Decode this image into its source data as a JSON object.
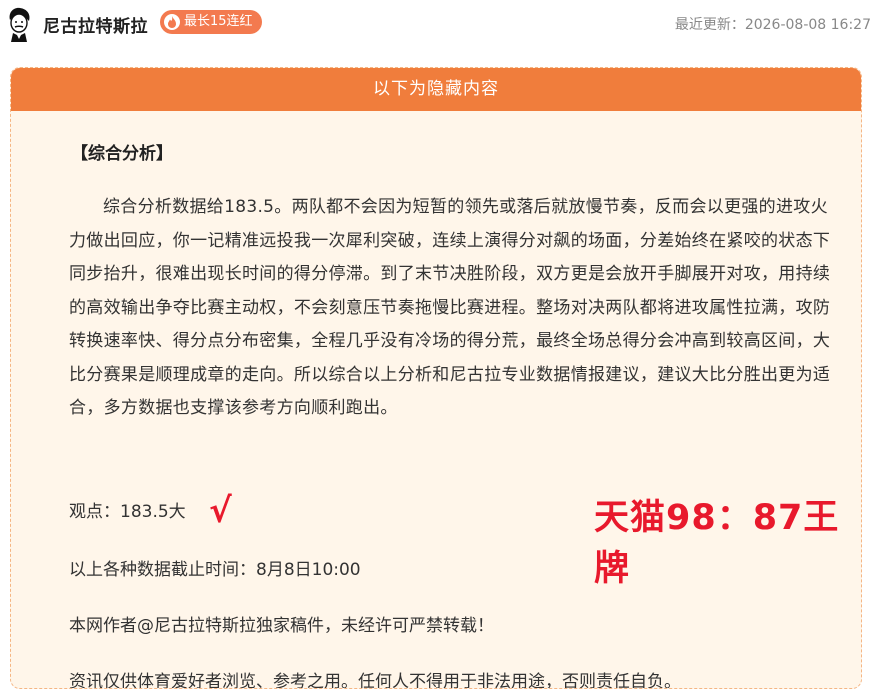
{
  "header": {
    "author_name": "尼古拉特斯拉",
    "streak_badge": "最长15连红",
    "updated": "最近更新：2026-08-08 16:27"
  },
  "card": {
    "banner": "以下为隐藏内容",
    "section_title": "【综合分析】",
    "paragraph": "综合分析数据给183.5。两队都不会因为短暂的领先或落后就放慢节奏，反而会以更强的进攻火力做出回应，你一记精准远投我一次犀利突破，连续上演得分对飙的场面，分差始终在紧咬的状态下同步抬升，很难出现长时间的得分停滞。到了末节决胜阶段，双方更是会放开手脚展开对攻，用持续的高效输出争夺比赛主动权，不会刻意压节奏拖慢比赛进程。整场对决两队都将进攻属性拉满，攻防转换速率快、得分点分布密集，全程几乎没有冷场的得分荒，最终全场总得分会冲高到较高区间，大比分赛果是顺理成章的走向。所以综合以上分析和尼古拉专业数据情报建议，建议大比分胜出更为适合，多方数据也支撑该参考方向顺利跑出。",
    "opinion": "观点：183.5大",
    "check": "√",
    "result": "天猫98：87王牌",
    "cutoff": "以上各种数据截止时间：8月8日10:00",
    "copyright": "本网作者@尼古拉特斯拉独家稿件，未经许可严禁转载！",
    "disclaimer": "资讯仅供体育爱好者浏览、参考之用。任何人不得用于非法用途，否则责任自负。"
  },
  "colors": {
    "accent_orange": "#f07d3c",
    "badge_orange": "#f37a4f",
    "result_red": "#e8192c",
    "card_bg": "#fff6ea"
  }
}
